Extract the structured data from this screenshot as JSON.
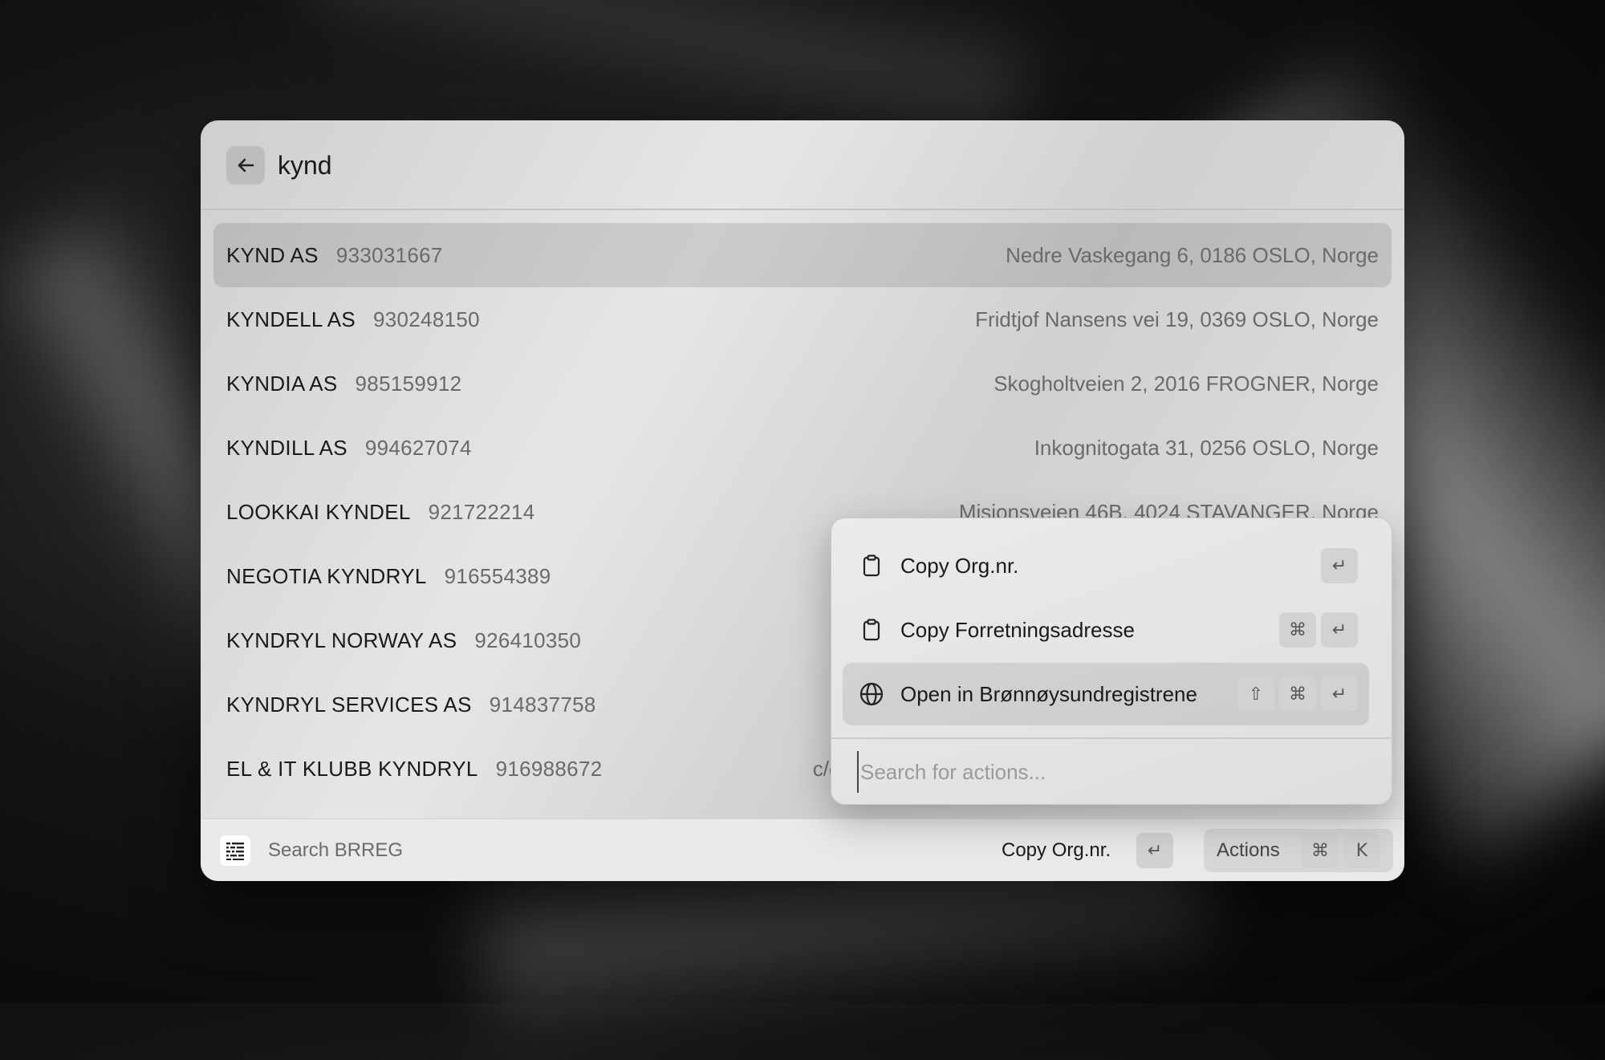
{
  "search": {
    "query": "kynd"
  },
  "results": [
    {
      "name": "KYND AS",
      "org": "933031667",
      "address": "Nedre Vaskegang 6, 0186 OSLO, Norge"
    },
    {
      "name": "KYNDELL AS",
      "org": "930248150",
      "address": "Fridtjof Nansens vei 19, 0369 OSLO, Norge"
    },
    {
      "name": "KYNDIA AS",
      "org": "985159912",
      "address": "Skogholtveien 2, 2016 FROGNER, Norge"
    },
    {
      "name": "KYNDILL AS",
      "org": "994627074",
      "address": "Inkognitogata 31, 0256 OSLO, Norge"
    },
    {
      "name": "LOOKKAI KYNDEL",
      "org": "921722214",
      "address": "Misjonsveien 46B, 4024 STAVANGER, Norge"
    },
    {
      "name": "NEGOTIA KYNDRYL",
      "org": "916554389",
      "address": ""
    },
    {
      "name": "KYNDRYL NORWAY AS",
      "org": "926410350",
      "address": ""
    },
    {
      "name": "KYNDRYL SERVICES AS",
      "org": "914837758",
      "address": ""
    },
    {
      "name": "EL & IT KLUBB KYNDRYL",
      "org": "916988672",
      "address": "c/c"
    }
  ],
  "footer": {
    "title": "Search BRREG",
    "primary_action": "Copy Org.nr.",
    "primary_shortcut": "↵",
    "actions_label": "Actions",
    "actions_shortcut": [
      "⌘",
      "K"
    ]
  },
  "action_panel": {
    "items": [
      {
        "label": "Copy Org.nr.",
        "icon": "clipboard-icon",
        "shortcut": [
          "↵"
        ]
      },
      {
        "label": "Copy Forretningsadresse",
        "icon": "clipboard-icon",
        "shortcut": [
          "⌘",
          "↵"
        ]
      },
      {
        "label": "Open in Brønnøysundregistrene",
        "icon": "globe-icon",
        "shortcut": [
          "⇧",
          "⌘",
          "↵"
        ]
      }
    ],
    "search_placeholder": "Search for actions..."
  }
}
